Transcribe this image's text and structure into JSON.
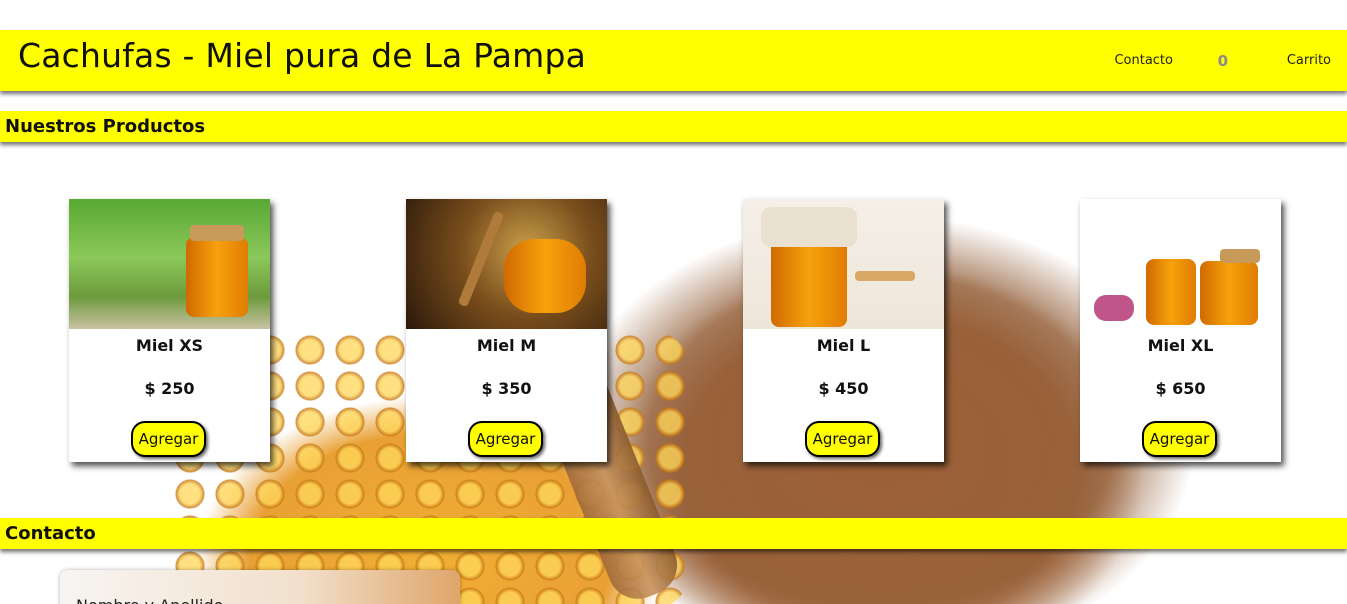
{
  "header": {
    "title": "Cachufas - Miel pura de La Pampa",
    "nav_contact": "Contacto",
    "cart_count": "0",
    "nav_cart": "Carrito"
  },
  "sections": {
    "products": "Nuestros Productos",
    "contact": "Contacto"
  },
  "products": [
    {
      "name": "Miel XS",
      "price": "$ 250",
      "button": "Agregar"
    },
    {
      "name": "Miel M",
      "price": "$ 350",
      "button": "Agregar"
    },
    {
      "name": "Miel L",
      "price": "$ 450",
      "button": "Agregar"
    },
    {
      "name": "Miel XL",
      "price": "$ 650",
      "button": "Agregar"
    }
  ],
  "contact_form": {
    "label": "Nombre y Apellido"
  }
}
